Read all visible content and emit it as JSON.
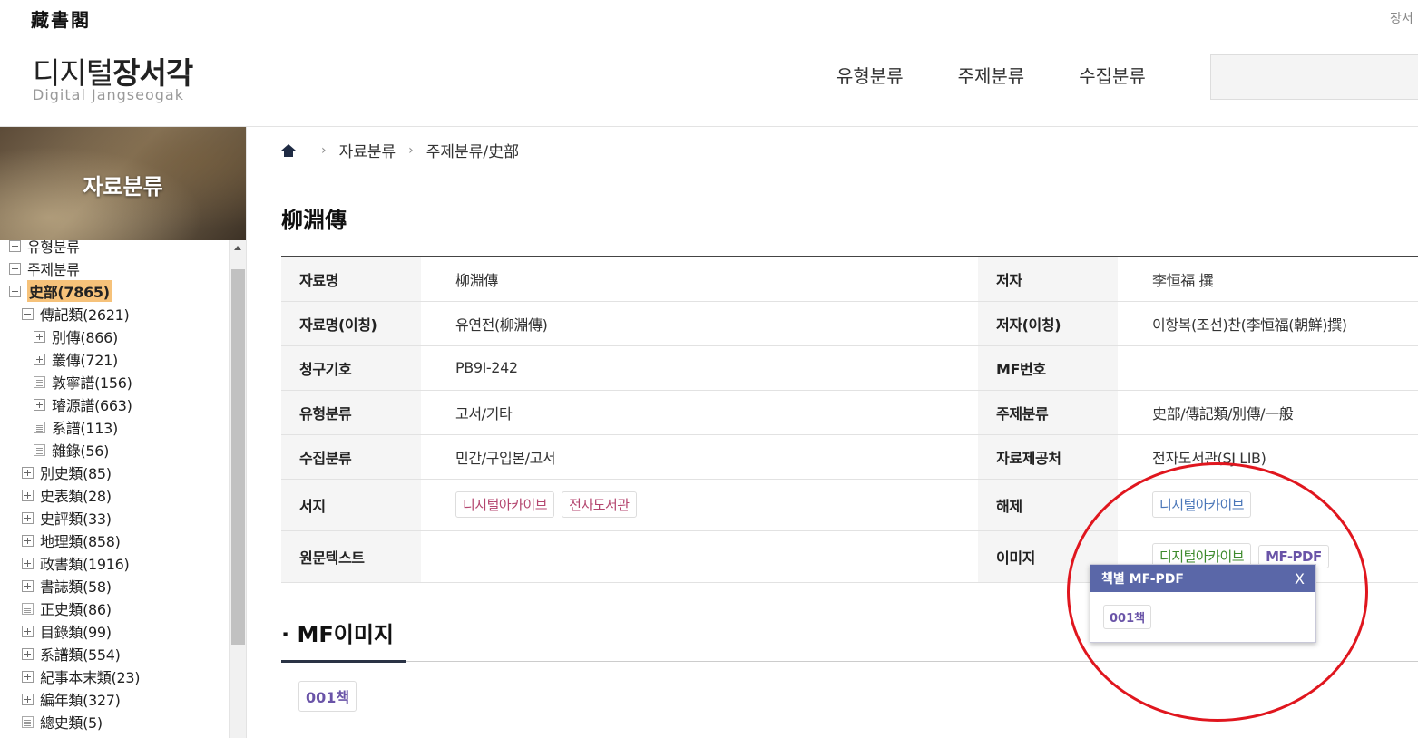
{
  "header": {
    "logo_hanja": "藏書閣",
    "logo_title_light": "디지털",
    "logo_title_bold": "장서각",
    "logo_subtitle": "Digital Jangseogak",
    "top_right": "장서",
    "nav": [
      "유형분류",
      "주제분류",
      "수집분류"
    ]
  },
  "sidebar": {
    "banner": "자료분류",
    "tree": [
      {
        "label": "유형분류",
        "icon": "plus",
        "level": 0
      },
      {
        "label": "주제분류",
        "icon": "minus",
        "level": 0
      },
      {
        "label": "史部(7865)",
        "icon": "minus",
        "level": 1,
        "selected": true
      },
      {
        "label": "傳記類(2621)",
        "icon": "minus",
        "level": 2
      },
      {
        "label": "別傳(866)",
        "icon": "plus",
        "level": 3
      },
      {
        "label": "叢傳(721)",
        "icon": "plus",
        "level": 3
      },
      {
        "label": "敦寧譜(156)",
        "icon": "doc",
        "level": 3
      },
      {
        "label": "璿源譜(663)",
        "icon": "plus",
        "level": 3
      },
      {
        "label": "系譜(113)",
        "icon": "doc",
        "level": 3
      },
      {
        "label": "雜錄(56)",
        "icon": "doc",
        "level": 3
      },
      {
        "label": "別史類(85)",
        "icon": "plus",
        "level": 2
      },
      {
        "label": "史表類(28)",
        "icon": "plus",
        "level": 2
      },
      {
        "label": "史評類(33)",
        "icon": "plus",
        "level": 2
      },
      {
        "label": "地理類(858)",
        "icon": "plus",
        "level": 2
      },
      {
        "label": "政書類(1916)",
        "icon": "plus",
        "level": 2
      },
      {
        "label": "書誌類(58)",
        "icon": "plus",
        "level": 2
      },
      {
        "label": "正史類(86)",
        "icon": "doc",
        "level": 2
      },
      {
        "label": "目錄類(99)",
        "icon": "plus",
        "level": 2
      },
      {
        "label": "系譜類(554)",
        "icon": "plus",
        "level": 2
      },
      {
        "label": "紀事本末類(23)",
        "icon": "plus",
        "level": 2
      },
      {
        "label": "編年類(327)",
        "icon": "plus",
        "level": 2
      },
      {
        "label": "總史類(5)",
        "icon": "doc",
        "level": 2
      }
    ]
  },
  "breadcrumb": [
    "자료분류",
    "주제분류/史部"
  ],
  "title": "柳淵傳",
  "info": {
    "r1": {
      "k1": "자료명",
      "v1": "柳淵傳",
      "k2": "저자",
      "v2": "李恒福 撰"
    },
    "r2": {
      "k1": "자료명(이칭)",
      "v1": "유연전(柳淵傳)",
      "k2": "저자(이칭)",
      "v2": "이항복(조선)찬(李恒福(朝鮮)撰)"
    },
    "r3": {
      "k1": "청구기호",
      "v1": "PB9I-242",
      "k2": "MF번호",
      "v2": ""
    },
    "r4": {
      "k1": "유형분류",
      "v1": "고서/기타",
      "k2": "주제분류",
      "v2": "史部/傳記類/別傳/一般"
    },
    "r5": {
      "k1": "수집분류",
      "v1": "민간/구입본/고서",
      "k2": "자료제공처",
      "v2": "전자도서관(SJ LIB)"
    },
    "r6": {
      "k1": "서지",
      "b1": "디지털아카이브",
      "b2": "전자도서관",
      "k2": "해제",
      "b3": "디지털아카이브"
    },
    "r7": {
      "k1": "원문텍스트",
      "k2": "이미지",
      "b1": "디지털아카이브",
      "b2": "MF-PDF"
    }
  },
  "mf_section": {
    "title": "· MF이미지",
    "button": "001책"
  },
  "popup": {
    "title": "책별 MF-PDF",
    "close": "X",
    "button": "001책"
  },
  "colors": {
    "popup_header": "#5a67a8",
    "annotation": "#e0161e",
    "selected": "#f6c27a"
  }
}
